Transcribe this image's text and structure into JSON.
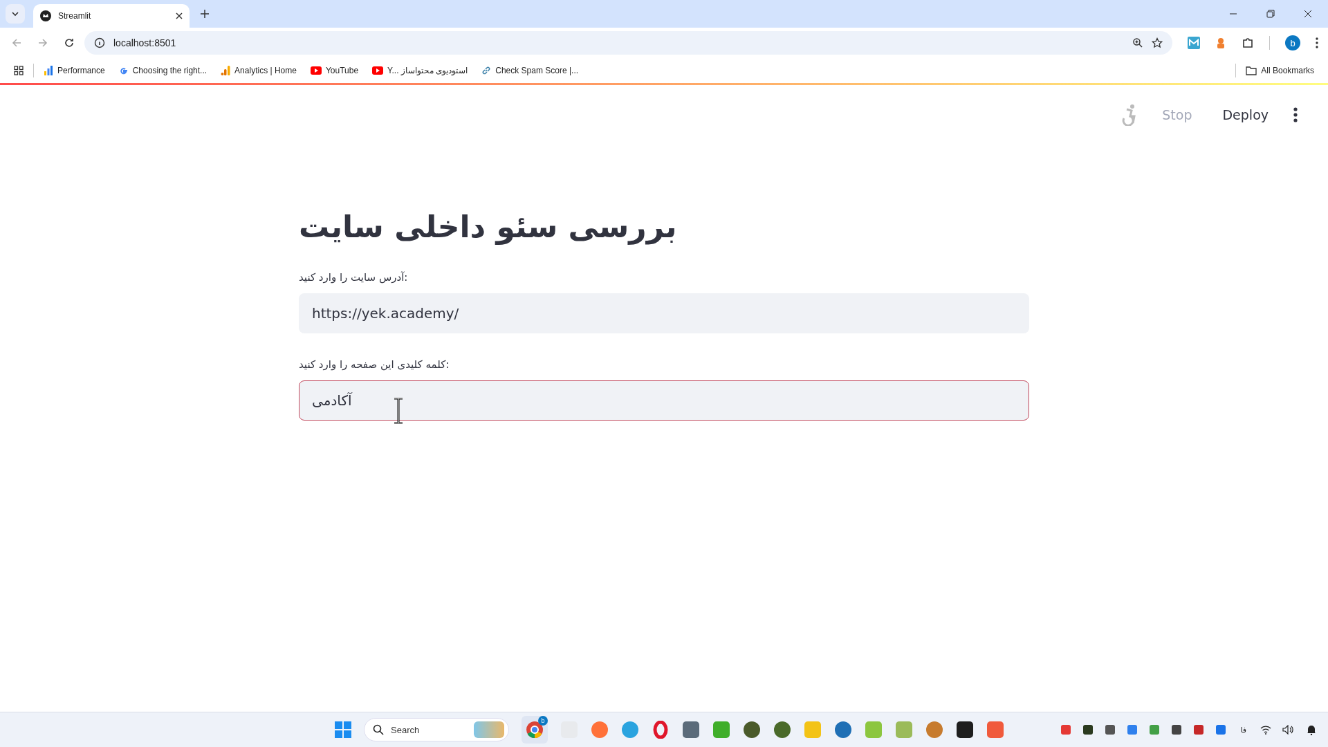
{
  "browser": {
    "tab": {
      "title": "Streamlit",
      "selected": true
    },
    "address": "localhost:8501",
    "profile_initial": "b",
    "all_bookmarks": "All Bookmarks",
    "bookmarks": [
      {
        "label": "Performance",
        "kind": "bars"
      },
      {
        "label": "Choosing the right...",
        "kind": "google"
      },
      {
        "label": "Analytics | Home",
        "kind": "analytics"
      },
      {
        "label": "YouTube",
        "kind": "youtube"
      },
      {
        "label": "Y... استودیوی محتواساز",
        "kind": "youtube"
      },
      {
        "label": "Check Spam Score |...",
        "kind": "link"
      }
    ]
  },
  "app_header": {
    "stop": "Stop",
    "deploy": "Deploy"
  },
  "page": {
    "title": "بررسی سئو داخلی سایت",
    "fields": [
      {
        "label": "آدرس سایت را وارد کنید:",
        "value": "https://yek.academy/",
        "focused": false
      },
      {
        "label": "کلمه کلیدی این صفحه را وارد کنید:",
        "value": "آکادمی",
        "focused": true
      }
    ]
  },
  "taskbar": {
    "search_placeholder": "Search",
    "browser_badge": "b",
    "language": "فا"
  }
}
